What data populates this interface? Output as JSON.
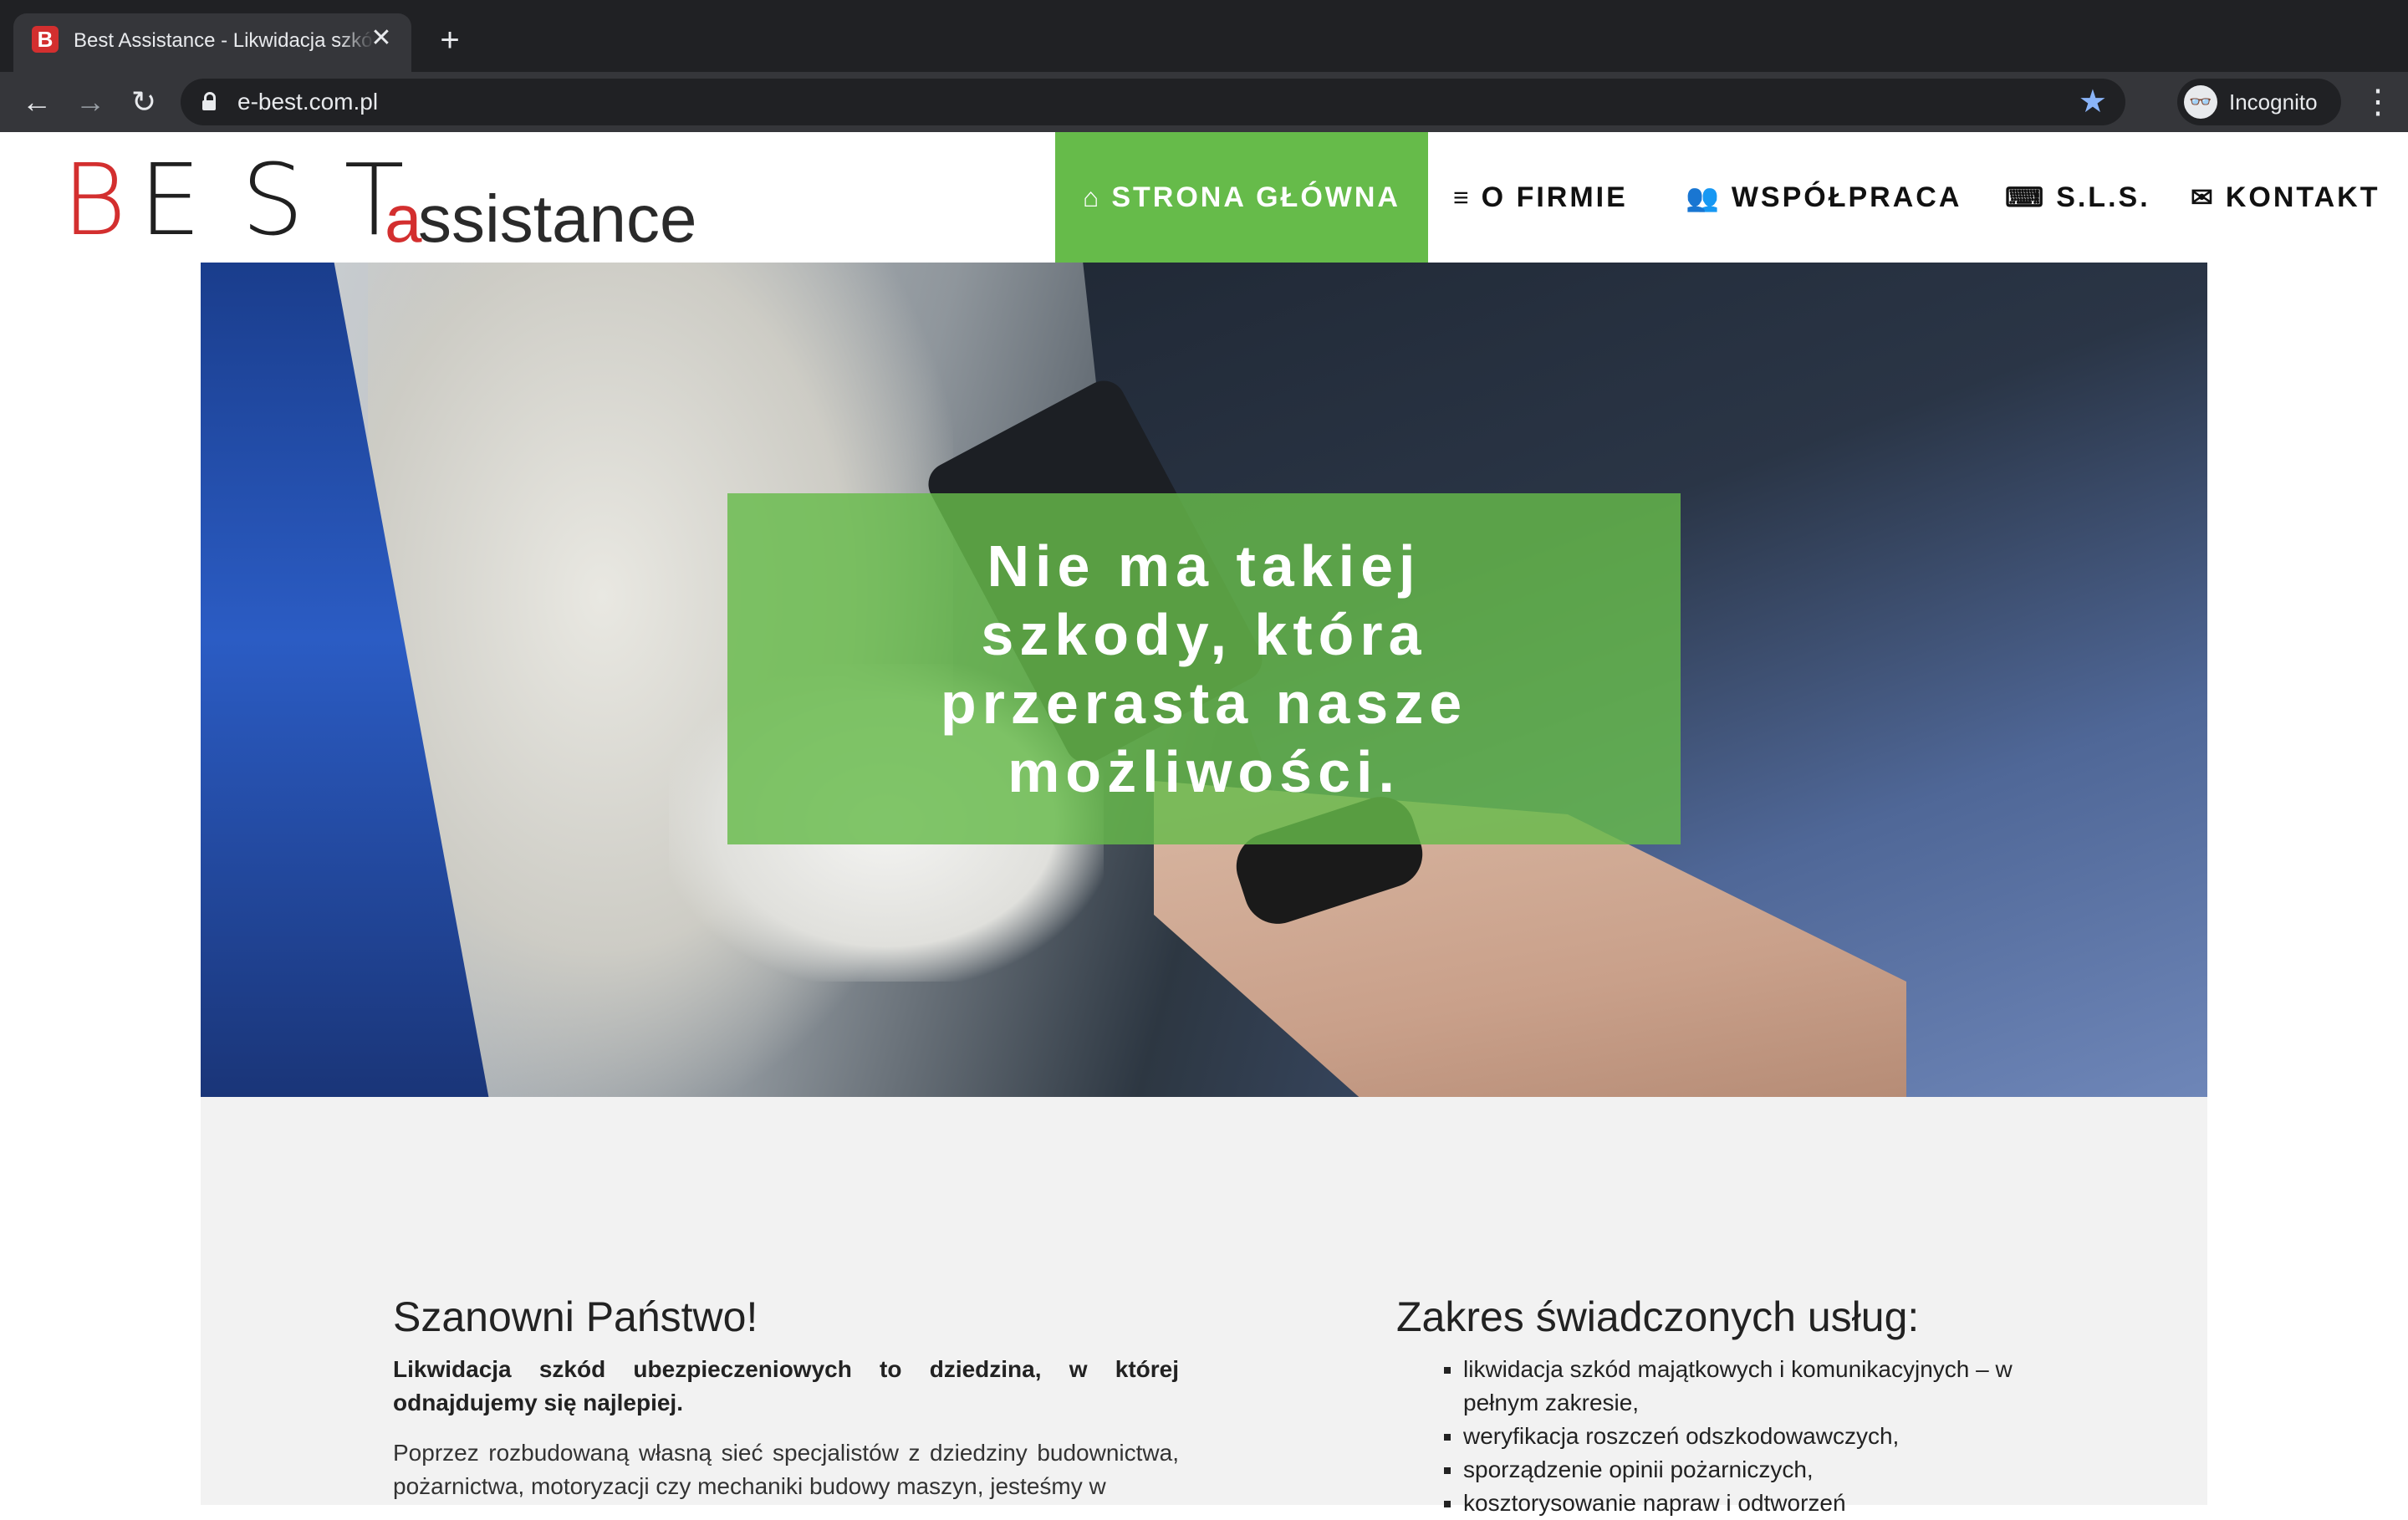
{
  "browser": {
    "tab_title": "Best Assistance - Likwidacja szkód",
    "favicon_letter": "B",
    "tab_close": "✕",
    "new_tab": "+",
    "url": "e-best.com.pl",
    "incognito_label": "Incognito",
    "icons": [
      "back-arrow-icon",
      "forward-arrow-icon",
      "reload-icon",
      "lock-icon",
      "star-icon",
      "incognito-icon",
      "menu-dots-icon"
    ]
  },
  "site": {
    "logo": {
      "b": "B",
      "est": "EST",
      "a": "a",
      "rest": "ssistance"
    },
    "nav": [
      {
        "icon": "⌂",
        "icon_name": "home-icon",
        "label": "STRONA GŁÓWNA",
        "active": true
      },
      {
        "icon": "≡",
        "icon_name": "bars-icon",
        "label": "O FIRMIE",
        "active": false
      },
      {
        "icon": "👥",
        "icon_name": "users-icon",
        "label": "WSPÓŁPRACA",
        "active": false
      },
      {
        "icon": "⌨",
        "icon_name": "keyboard-icon",
        "label": "S.L.S.",
        "active": false
      },
      {
        "icon": "✉",
        "icon_name": "envelope-icon",
        "label": "KONTAKT",
        "active": false
      }
    ],
    "accent_color": "#66bb4a",
    "hero": {
      "line1": "Nie ma takiej",
      "line2": "szkody, która",
      "line3": "przerasta nasze",
      "line4": "możliwości."
    },
    "intro": {
      "heading": "Szanowni Państwo!",
      "lead": "Likwidacja szkód ubezpieczeniowych to dziedzina, w której odnajdujemy się najlepiej.",
      "para": "Poprzez rozbudowaną własną sieć specjalistów z dziedziny budownictwa, pożarnictwa, motoryzacji czy mechaniki budowy maszyn, jesteśmy w"
    },
    "services": {
      "heading": "Zakres świadczonych usług:",
      "items": [
        "likwidacja szkód majątkowych i komunikacyjnych – w pełnym zakresie,",
        "weryfikacja roszczeń odszkodowawczych,",
        "sporządzenie opinii pożarniczych,",
        "kosztorysowanie napraw i odtworzeń"
      ]
    }
  }
}
